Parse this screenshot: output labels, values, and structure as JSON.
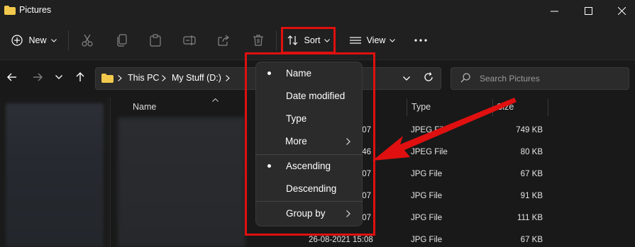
{
  "window": {
    "title": "Pictures",
    "controls": [
      "minimize-icon",
      "maximize-icon",
      "close-icon"
    ]
  },
  "toolbar": {
    "new_label": "New",
    "sort_label": "Sort",
    "view_label": "View",
    "icons": [
      "cut-icon",
      "copy-icon",
      "paste-icon",
      "rename-icon",
      "share-icon",
      "delete-icon",
      "more-options-icon"
    ]
  },
  "address": {
    "segments": [
      "This PC",
      "My Stuff (D:)"
    ],
    "search_placeholder": "Search Pictures"
  },
  "columns": {
    "name": "Name",
    "type": "Type",
    "size": "Size"
  },
  "files": [
    {
      "date": "07",
      "type": "JPEG File",
      "size": "749 KB"
    },
    {
      "date": "46",
      "type": "JPEG File",
      "size": "80 KB"
    },
    {
      "date": "07",
      "type": "JPG File",
      "size": "67 KB"
    },
    {
      "date": "07",
      "type": "JPG File",
      "size": "91 KB"
    },
    {
      "date": "07",
      "type": "JPG File",
      "size": "111 KB"
    },
    {
      "date": "26-08-2021 15:08",
      "type": "JPG File",
      "size": "67 KB"
    }
  ],
  "sort_menu": {
    "items": [
      {
        "label": "Name",
        "selected": true
      },
      {
        "label": "Date modified",
        "selected": false
      },
      {
        "label": "Type",
        "selected": false
      },
      {
        "label": "More",
        "submenu": true
      }
    ],
    "order_items": [
      {
        "label": "Ascending",
        "selected": true
      },
      {
        "label": "Descending",
        "selected": false
      }
    ],
    "group_by": {
      "label": "Group by",
      "submenu": true
    }
  },
  "colors": {
    "highlight": "#e01010",
    "arrow": "#e01010",
    "folder": "#f2c94c"
  }
}
